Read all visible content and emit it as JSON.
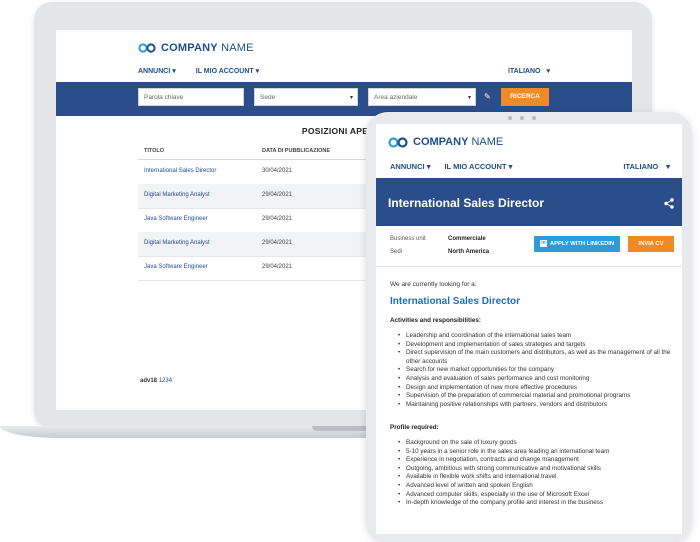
{
  "brand": {
    "company": "COMPANY",
    "name": "NAME",
    "accent": "#2b4e8b",
    "orange": "#f08a24",
    "blue": "#2e9bd8"
  },
  "laptop": {
    "nav": [
      {
        "label": "ANNUNCI"
      },
      {
        "label": "IL MIO ACCOUNT"
      }
    ],
    "language": "ITALIANO",
    "search": {
      "keyword_placeholder": "Parola chiave",
      "location_value": "Sede",
      "area_value": "Area aziendale",
      "button": "RICERCA"
    },
    "title": "POSIZIONI APERTE",
    "table": {
      "headers": [
        "TITOLO",
        "DATA DI PUBBLICAZIONE"
      ],
      "rows": [
        {
          "title": "International Sales Director",
          "date": "30/04/2021"
        },
        {
          "title": "Digital Marketing Analyst",
          "date": "29/04/2021"
        },
        {
          "title": "Java Software Engineer",
          "date": "29/04/2021"
        },
        {
          "title": "Digital Marketing Analyst",
          "date": "29/04/2021"
        },
        {
          "title": "Java Software Engineer",
          "date": "29/04/2021"
        }
      ]
    },
    "pager": {
      "prefix": "adv18",
      "pages": "1234"
    }
  },
  "tablet": {
    "nav": [
      {
        "label": "ANNUNCI"
      },
      {
        "label": "IL MIO ACCOUNT"
      }
    ],
    "language": "ITALIANO",
    "job_title": "International Sales Director",
    "meta": [
      {
        "label": "Business unit",
        "value": "Commerciale"
      },
      {
        "label": "Sedi",
        "value": "North America"
      }
    ],
    "apply_linkedin": "APPLY WITH LINKEDIN",
    "send_cv": "INVIA CV",
    "intro": "We are currently looking for a:",
    "heading": "International Sales Director",
    "activities_title": "Activities and responsibilities:",
    "activities": [
      "Leadership and coordination of the international sales team",
      "Development and implementation of sales strategies and targets",
      "Direct supervision of the main customers and distributors, as well as the management of all the other accounts",
      "Search for new market opportunities for the company",
      "Analysis and evaluation of sales performance and cost monitoring",
      "Design and implementation of new more effective procedures",
      "Supervision of the preparation of commercial material and promotional programs",
      "Maintaining positive relationships with partners, vendors and distributors"
    ],
    "profile_title": "Profile required:",
    "profile": [
      "Background on the sale of luxury goods",
      "5-10 years in a senior role in the sales area leading an international team",
      "Experience in negotiation, contracts and change management",
      "Outgoing, ambitious with strong communicative and motivational skills",
      "Available in flexible work shifts and international travel",
      "Advanced level of written and spoken English",
      "Advanced computer skills, especially in the use of Microsoft Excel",
      "In-depth knowledge of the company profile and interest in the business"
    ]
  }
}
